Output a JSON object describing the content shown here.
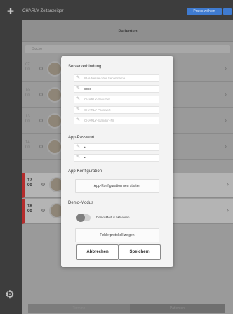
{
  "app": {
    "title": "CHARLY Zeitanzeiger",
    "top_buttons": [
      "Praxis wählen",
      ""
    ]
  },
  "main": {
    "title": "Patienten",
    "search_placeholder": "Suche",
    "rows": [
      {
        "date": "07 00",
        "selected": false
      },
      {
        "date": "10 00",
        "selected": false
      },
      {
        "date": "13 00",
        "selected": false
      },
      {
        "date": "14 00",
        "selected": false
      },
      {
        "date": "17 00",
        "selected": true
      },
      {
        "date": "18 00",
        "selected": true
      }
    ],
    "bottom_tabs": [
      "Termine",
      "Patienten"
    ]
  },
  "dialog": {
    "server": {
      "title": "Serververbindung",
      "fields": [
        {
          "placeholder": "IP-Adresse oder Servername",
          "value": ""
        },
        {
          "placeholder": "",
          "value": "8080"
        },
        {
          "placeholder": "CHARLY-Benutzer",
          "value": ""
        },
        {
          "placeholder": "CHARLY-Passwort",
          "value": ""
        },
        {
          "placeholder": "CHARLY-Standort-Nr.",
          "value": ""
        }
      ]
    },
    "app_password": {
      "title": "App-Passwort",
      "fields": [
        {
          "value": "•"
        },
        {
          "value": "•"
        }
      ]
    },
    "app_config": {
      "title": "App-Konfiguration",
      "restart_label": "App-Konfiguration neu starten"
    },
    "demo": {
      "title": "Demo-Modus",
      "toggle_label": "Demo-Modus aktivieren",
      "enabled": false
    },
    "error_log_label": "Fehlerprotokoll zeigen",
    "cancel_label": "Abbrechen",
    "save_label": "Speichern"
  },
  "colors": {
    "accent_blue": "#3f7bd0",
    "selection_red": "#b52c2c"
  }
}
